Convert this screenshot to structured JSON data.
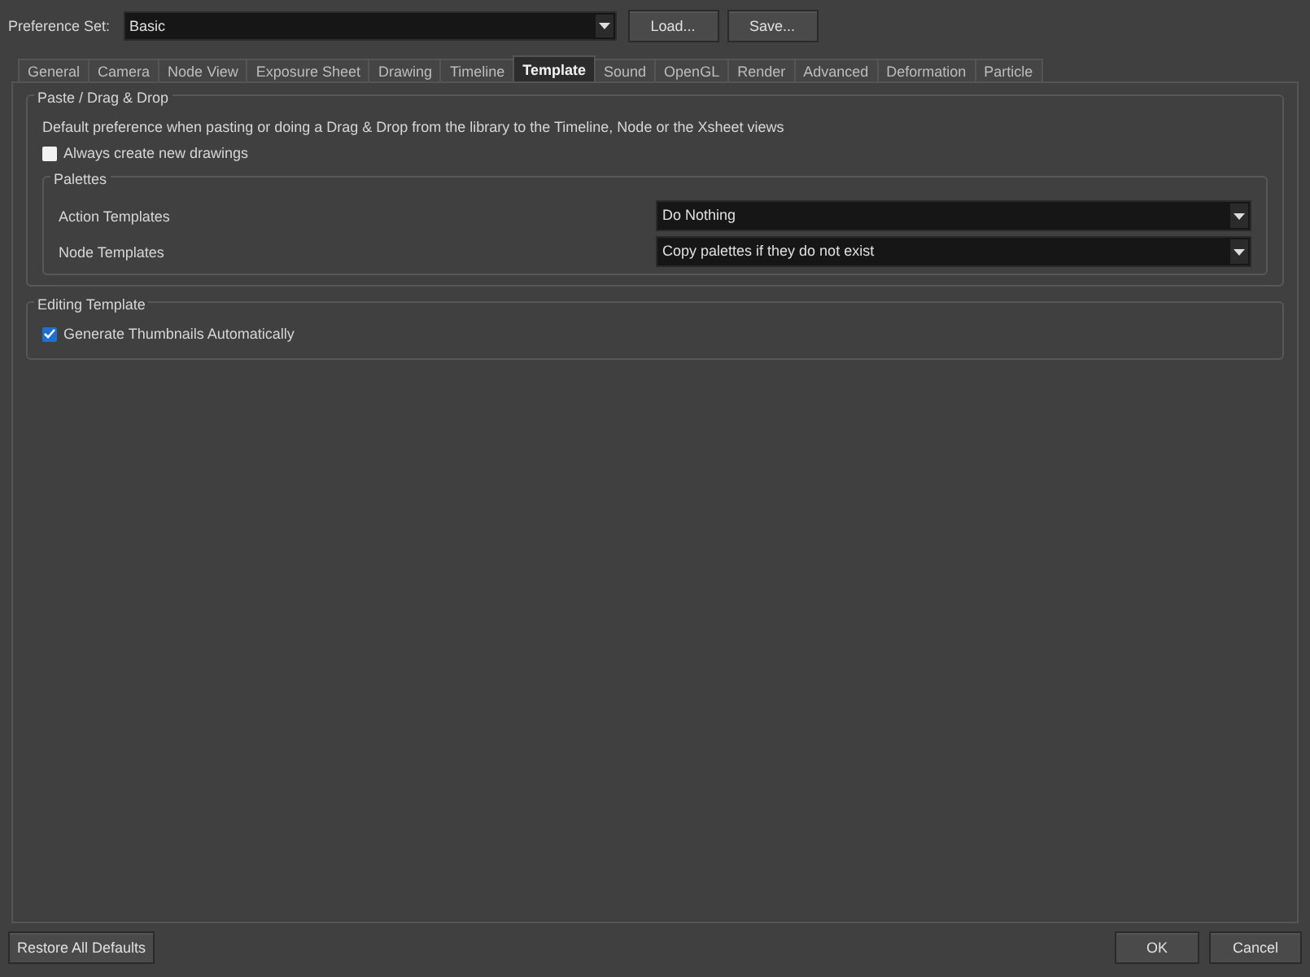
{
  "preference_set": {
    "label": "Preference Set:",
    "value": "Basic",
    "buttons": [
      "Load...",
      "Save..."
    ]
  },
  "tabs": [
    {
      "label": "General",
      "selected": false
    },
    {
      "label": "Camera",
      "selected": false
    },
    {
      "label": "Node View",
      "selected": false
    },
    {
      "label": "Exposure Sheet",
      "selected": false
    },
    {
      "label": "Drawing",
      "selected": false
    },
    {
      "label": "Timeline",
      "selected": false
    },
    {
      "label": "Template",
      "selected": true
    },
    {
      "label": "Sound",
      "selected": false
    },
    {
      "label": "OpenGL",
      "selected": false
    },
    {
      "label": "Render",
      "selected": false
    },
    {
      "label": "Advanced",
      "selected": false
    },
    {
      "label": "Deformation",
      "selected": false
    },
    {
      "label": "Particle",
      "selected": false
    }
  ],
  "paste_group": {
    "title": "Paste / Drag & Drop",
    "description": "Default preference when pasting or doing a Drag & Drop from the library to the Timeline, Node or the Xsheet views",
    "checkbox": {
      "label": "Always create new drawings",
      "checked": false
    },
    "palettes": {
      "title": "Palettes",
      "rows": [
        {
          "label": "Action Templates",
          "value": "Do Nothing"
        },
        {
          "label": "Node Templates",
          "value": "Copy palettes if they do not exist"
        }
      ]
    }
  },
  "editing_group": {
    "title": "Editing Template",
    "checkbox": {
      "label": "Generate Thumbnails Automatically",
      "checked": true
    }
  },
  "footer": {
    "restore": "Restore All Defaults",
    "ok": "OK",
    "cancel": "Cancel"
  }
}
